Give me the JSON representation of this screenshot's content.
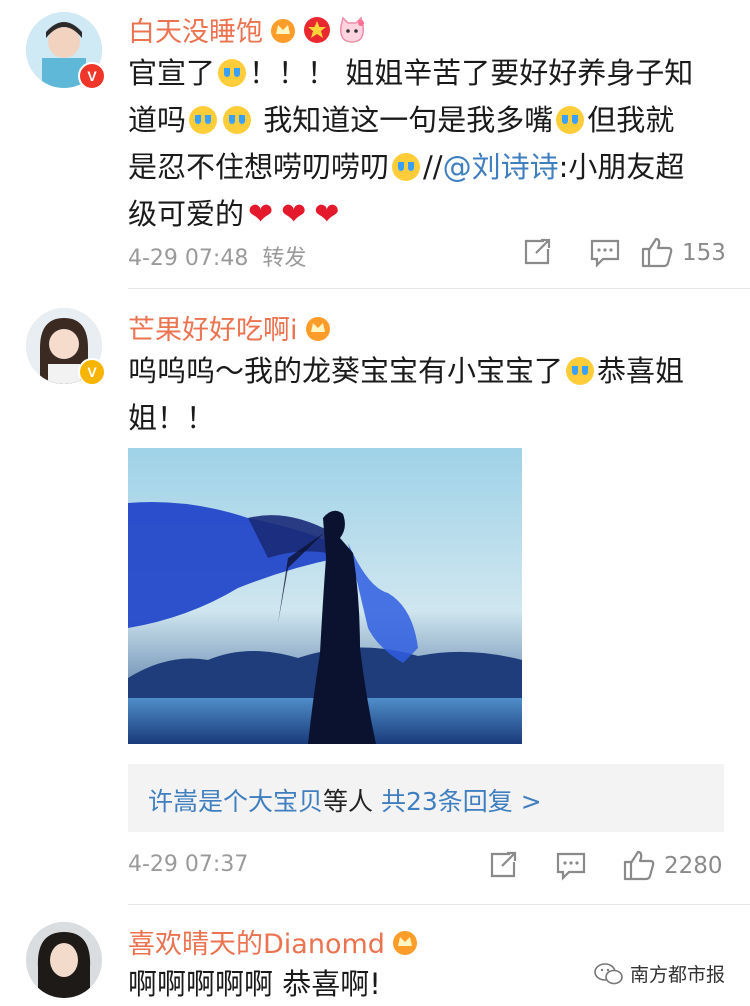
{
  "comments": [
    {
      "username": "白天没睡饱",
      "text_parts": {
        "p1": "官宣了",
        "p2": "！！！ 姐姐辛苦了要好好养身子知",
        "p3": "道吗",
        "p4": "我知道这一句是我多嘴",
        "p5": "但我就",
        "p6": "是忍不住想唠叨唠叨",
        "p7": "//",
        "mention": "@刘诗诗",
        "p8": ":小朋友超",
        "p9": "级可爱的"
      },
      "time": "4-29 07:48",
      "forward_label": "转发",
      "like_count": "153"
    },
    {
      "username": "芒果好好吃啊i",
      "text_parts": {
        "p1": "呜呜呜～我的龙葵宝宝有小宝宝了",
        "p2": "恭喜姐",
        "p3": "姐！！"
      },
      "reply_summary": {
        "names": "许嵩是个大宝贝",
        "middle": "等人",
        "count_text": "共23条回复 >"
      },
      "time": "4-29 07:37",
      "like_count": "2280"
    },
    {
      "username": "喜欢晴天的Dianomd",
      "text": "啊啊啊啊啊 恭喜啊!"
    }
  ],
  "watermark": "南方都市报",
  "colors": {
    "username": "#eb7350",
    "mention": "#3f7fbf",
    "meta": "#9a9a9a"
  }
}
